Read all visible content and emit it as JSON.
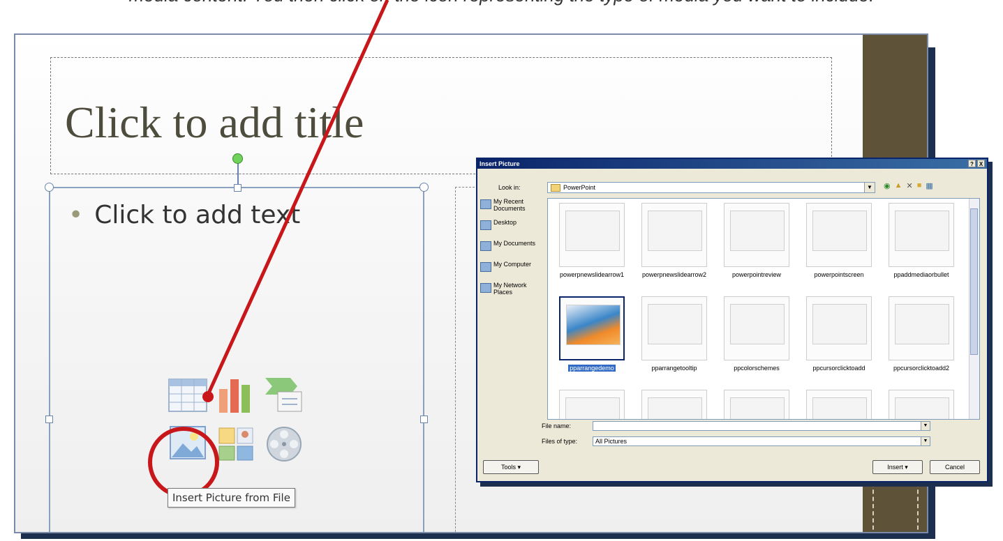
{
  "caption": "media content. You then click on the icon representing the type of media you want to include.",
  "slide": {
    "title_placeholder": "Click to add title",
    "bullet_text": "Click to add text",
    "tooltip": "Insert Picture from File"
  },
  "dialog": {
    "title": "Insert Picture",
    "title_buttons": [
      "?",
      "X"
    ],
    "look_in_label": "Look in:",
    "look_in_value": "PowerPoint",
    "places": [
      "My Recent Documents",
      "Desktop",
      "My Documents",
      "My Computer",
      "My Network Places"
    ],
    "thumbnails": [
      "powerpnewslidearrow1",
      "powerpnewslidearrow2",
      "powerpointreview",
      "powerpointscreen",
      "ppaddmediaorbullet",
      "pparrangedemo",
      "pparrangetooltip",
      "ppcolorschemes",
      "ppcursorclicktoadd",
      "ppcursorclicktoadd2",
      "",
      "",
      "",
      "",
      ""
    ],
    "selected_thumbnail": "pparrangedemo",
    "file_name_label": "File name:",
    "file_name_value": "",
    "files_of_type_label": "Files of type:",
    "files_of_type_value": "All Pictures",
    "tools_button": "Tools",
    "insert_button": "Insert",
    "cancel_button": "Cancel"
  },
  "colors": {
    "accent_red": "#c8171b",
    "brown_bar": "#5e5238",
    "title_text": "#4e4d3d",
    "xp_blue": "#0a246a"
  }
}
